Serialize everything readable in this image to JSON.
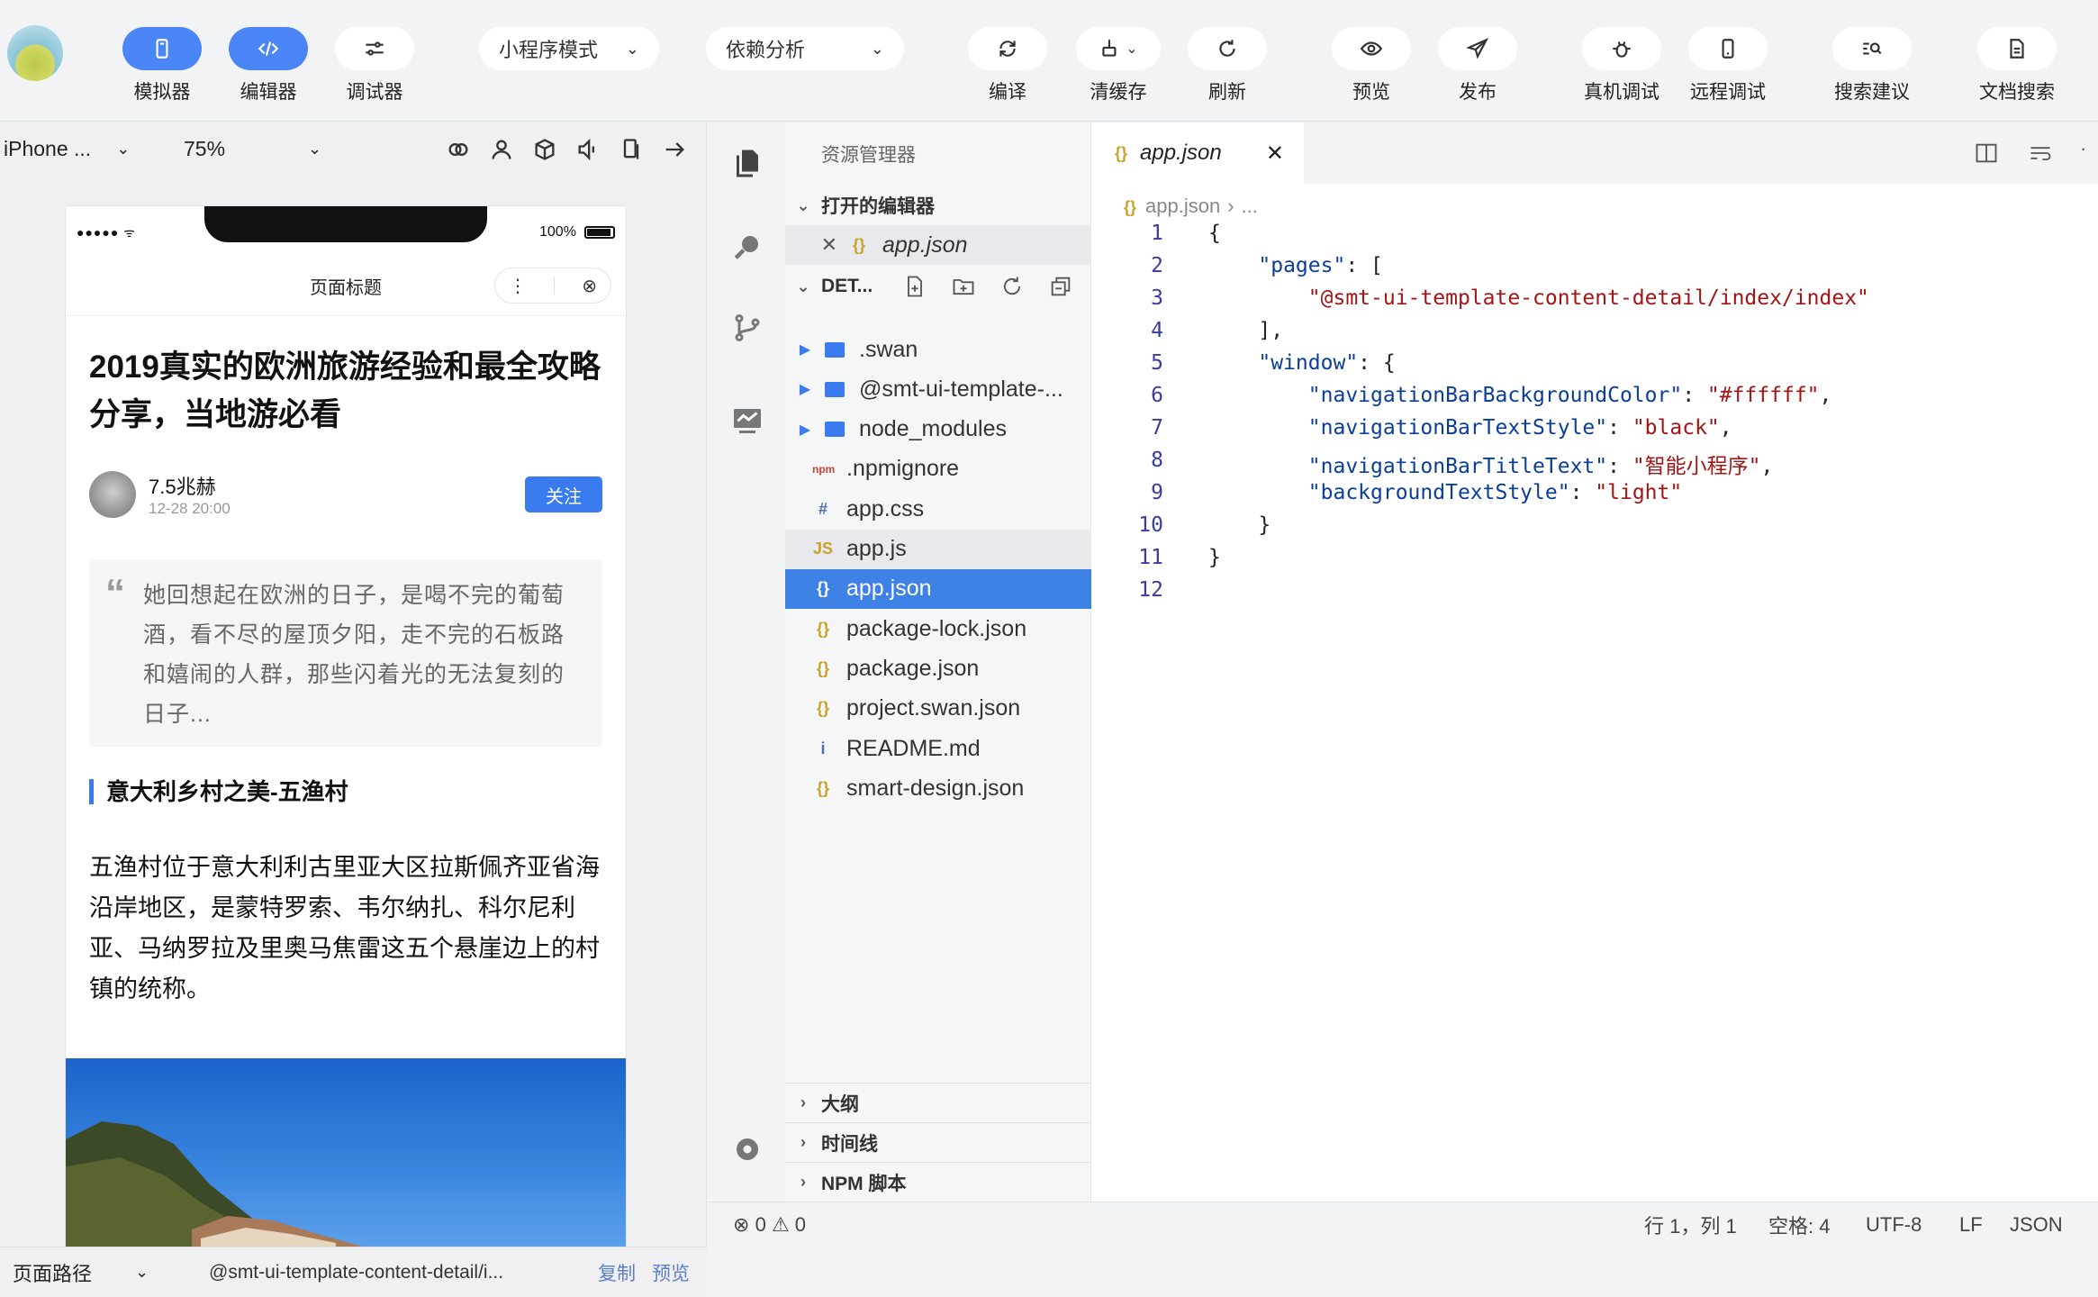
{
  "toolbar": {
    "simulator": "模拟器",
    "editor": "编辑器",
    "debugger": "调试器",
    "mode_select": "小程序模式",
    "dep_select": "依赖分析",
    "compile": "编译",
    "clear_cache": "清缓存",
    "refresh": "刷新",
    "preview": "预览",
    "publish": "发布",
    "real_debug": "真机调试",
    "remote_debug": "远程调试",
    "search_suggest": "搜索建议",
    "doc_search": "文档搜索"
  },
  "device": {
    "model": "iPhone ...",
    "zoom": "75%"
  },
  "phone": {
    "battery": "100%",
    "nav_title": "页面标题",
    "article_title": "2019真实的欧洲旅游经验和最全攻略分享，当地游必看",
    "author": "7.5兆赫",
    "time": "12-28 20:00",
    "follow": "关注",
    "quote_mark": "“",
    "quote": "她回想起在欧洲的日子，是喝不完的葡萄酒，看不尽的屋顶夕阳，走不完的石板路和嬉闹的人群，那些闪着光的无法复刻的日子...",
    "section_heading": "意大利乡村之美-五渔村",
    "paragraph": "五渔村位于意大利利古里亚大区拉斯佩齐亚省海沿岸地区，是蒙特罗索、韦尔纳扎、科尔尼利亚、马纳罗拉及里奥马焦雷这五个悬崖边上的村镇的统称。"
  },
  "pathbar": {
    "label": "页面路径",
    "path": "@smt-ui-template-content-detail/i...",
    "copy": "复制",
    "preview": "预览"
  },
  "explorer": {
    "title": "资源管理器",
    "open_editors": "打开的编辑器",
    "open_file": "app.json",
    "project": "DET...",
    "files": [
      {
        "name": ".swan",
        "icon": "folder"
      },
      {
        "name": "@smt-ui-template-...",
        "icon": "folder"
      },
      {
        "name": "node_modules",
        "icon": "folder"
      },
      {
        "name": ".npmignore",
        "icon": "npm"
      },
      {
        "name": "app.css",
        "icon": "#"
      },
      {
        "name": "app.js",
        "icon": "JS"
      },
      {
        "name": "app.json",
        "icon": "{}"
      },
      {
        "name": "package-lock.json",
        "icon": "{}"
      },
      {
        "name": "package.json",
        "icon": "{}"
      },
      {
        "name": "project.swan.json",
        "icon": "{}"
      },
      {
        "name": "README.md",
        "icon": "i"
      },
      {
        "name": "smart-design.json",
        "icon": "{}"
      }
    ],
    "outline": "大纲",
    "timeline": "时间线",
    "npm_scripts": "NPM 脚本"
  },
  "editor": {
    "tab": "app.json",
    "breadcrumb_file": "app.json",
    "breadcrumb_rest": "...",
    "lines": [
      "{",
      "    \"pages\": [",
      "        \"@smt-ui-template-content-detail/index/index\"",
      "    ],",
      "    \"window\": {",
      "        \"navigationBarBackgroundColor\": \"#ffffff\",",
      "        \"navigationBarTextStyle\": \"black\",",
      "        \"navigationBarTitleText\": \"智能小程序\",",
      "        \"backgroundTextStyle\": \"light\"",
      "    }",
      "}",
      ""
    ]
  },
  "statusbar": {
    "errors": "0",
    "warnings": "0",
    "position": "行 1，列 1",
    "spaces": "空格: 4",
    "encoding": "UTF-8",
    "eol": "LF",
    "language": "JSON"
  },
  "colors": {
    "accent": "#3a7bf0",
    "selection": "#3f82e6"
  }
}
